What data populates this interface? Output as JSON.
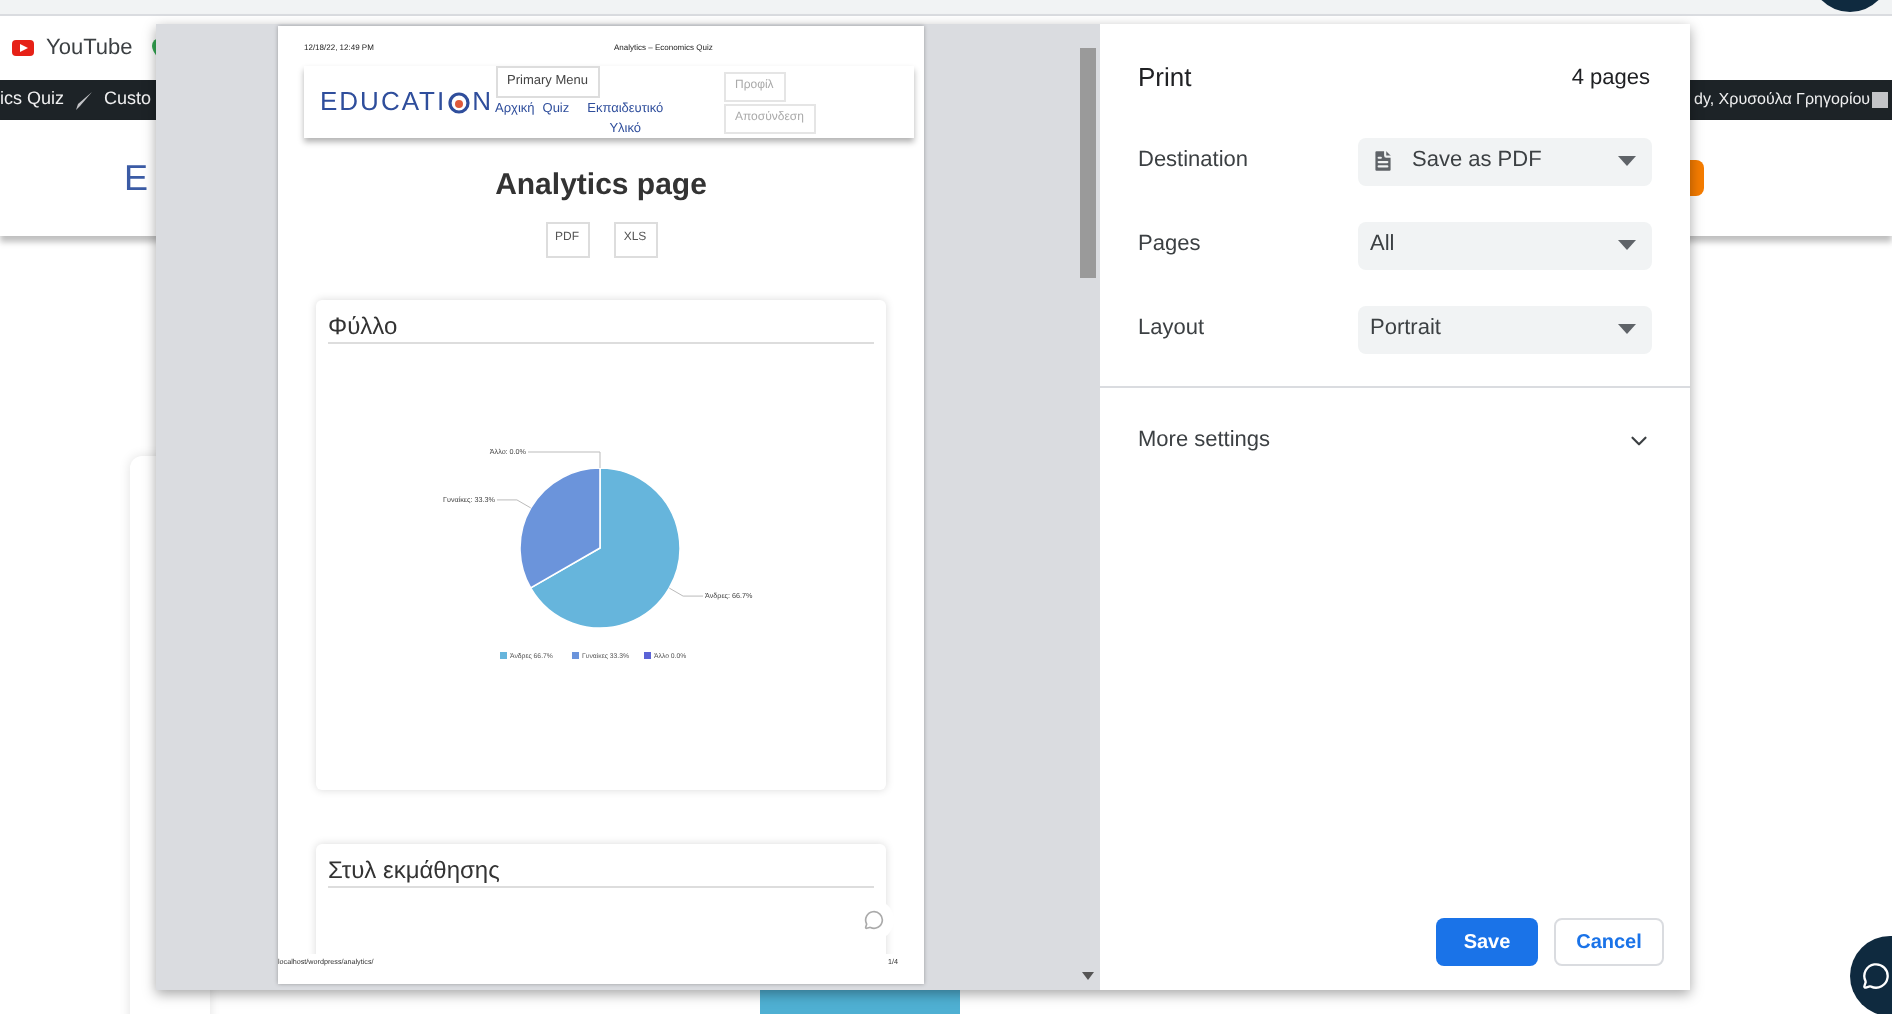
{
  "browser": {
    "bookmarks": [
      {
        "label": "YouTube"
      }
    ],
    "admin_bar": {
      "left": [
        "ics Quiz",
        "Custo"
      ],
      "right": "dy, Χρυσούλα Γρηγορίου"
    },
    "site_logo": "E"
  },
  "print_preview": {
    "page_header": {
      "date": "12/18/22, 12:49 PM",
      "title": "Analytics – Economics Quiz"
    },
    "site_nav": {
      "logo_start": "EDUCATI",
      "logo_end": "N",
      "menu_toggle": "Primary Menu",
      "links": [
        "Αρχική",
        "Quiz",
        "Εκπαιδευτικό Υλικό"
      ],
      "account_buttons": [
        "Προφίλ",
        "Αποσύνδεση"
      ]
    },
    "heading": "Analytics page",
    "export_buttons": [
      "PDF",
      "XLS"
    ],
    "cards": [
      {
        "title": "Φύλλο",
        "chart_data": {
          "type": "pie",
          "categories": [
            "Άνδρες",
            "Γυναίκες",
            "Άλλο"
          ],
          "values": [
            66.7,
            33.3,
            0
          ],
          "value_labels": [
            "Άνδρες: 66.7%",
            "Γυναίκες: 33.3%",
            "Άλλο: 0.0%"
          ]
        },
        "legend": [
          {
            "value": "66.7%",
            "color": "#66b5dc"
          },
          {
            "value": "33.3%",
            "color": "#6b94db"
          },
          {
            "value": "0.0%",
            "color": "#5b63d6"
          }
        ]
      },
      {
        "title": "Στυλ εκμάθησης"
      }
    ],
    "page_footer": {
      "url": "localhost/wordpress/analytics/",
      "page_number": "1/4"
    }
  },
  "print_settings": {
    "title": "Print",
    "page_count": "4 pages",
    "options": [
      {
        "label": "Destination",
        "value": "Save as PDF",
        "kind": "destination"
      },
      {
        "label": "Pages",
        "value": "All",
        "kind": "select"
      },
      {
        "label": "Layout",
        "value": "Portrait",
        "kind": "select"
      }
    ],
    "more_settings": {
      "label": "More settings",
      "expanded": false
    },
    "buttons": [
      {
        "label": "Save",
        "kind": "primary"
      },
      {
        "label": "Cancel",
        "kind": "secondary"
      }
    ]
  }
}
